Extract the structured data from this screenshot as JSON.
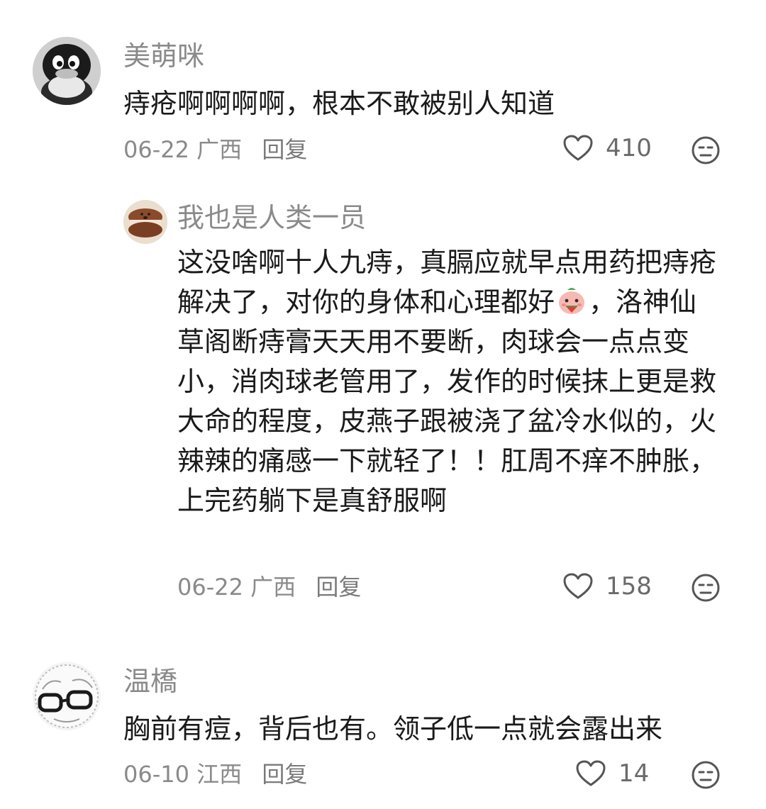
{
  "comments": [
    {
      "username": "美萌咪",
      "text": "痔疮啊啊啊啊，根本不敢被别人知道",
      "date": "06-22",
      "location": "广西",
      "reply_label": "回复",
      "likes": "410",
      "avatar_icon": "penguin-avatar-icon"
    },
    {
      "username": "我也是人类一员",
      "text_part1": "这没啥啊十人九痔，真膈应就早点用药把痔疮解决了，对你的身体和心理都好",
      "text_part2": "，洛神仙草阁断痔膏天天用不要断，肉球会一点点变小，消肉球老管用了，发作的时候抹上更是救大命的程度，皮燕子跟被浇了盆冷水似的，火辣辣的痛感一下就轻了！！肛周不痒不肿胀，上完药躺下是真舒服啊",
      "date": "06-22",
      "location": "广西",
      "reply_label": "回复",
      "likes": "158",
      "avatar_icon": "macaron-avatar-icon",
      "inline_emoji": "watermelon-smile-emoji"
    },
    {
      "username": "温橋",
      "text": "胸前有痘，背后也有。领子低一点就会露出来",
      "date": "06-10",
      "location": "江西",
      "reply_label": "回复",
      "likes": "14",
      "avatar_icon": "glasses-sketch-avatar-icon"
    }
  ],
  "colors": {
    "username": "#8a8a8a",
    "text": "#1a1a1a",
    "meta": "#8a8a8a",
    "icon": "#555555"
  }
}
